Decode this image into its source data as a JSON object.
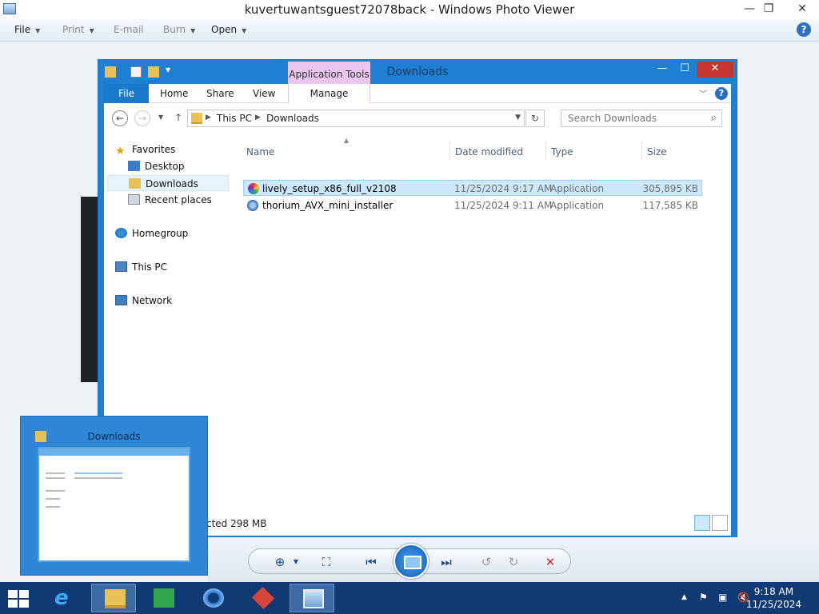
{
  "photo_viewer": {
    "title": "kuvertuwantsguest72078back - Windows Photo Viewer",
    "menu": {
      "file": "File",
      "print": "Print",
      "email": "E-mail",
      "burn": "Burn",
      "open": "Open"
    },
    "help": "?"
  },
  "explorer": {
    "title": "Downloads",
    "context_tab": "Application Tools",
    "tabs": {
      "file": "File",
      "home": "Home",
      "share": "Share",
      "view": "View",
      "manage": "Manage"
    },
    "breadcrumb": [
      "This PC",
      "Downloads"
    ],
    "search_placeholder": "Search Downloads",
    "nav": {
      "favorites": "Favorites",
      "desktop": "Desktop",
      "downloads": "Downloads",
      "recent": "Recent places",
      "homegroup": "Homegroup",
      "this_pc": "This PC",
      "network": "Network"
    },
    "columns": {
      "name": "Name",
      "date": "Date modified",
      "type": "Type",
      "size": "Size"
    },
    "files": [
      {
        "name": "lively_setup_x86_full_v2108",
        "date": "11/25/2024 9:17 AM",
        "type": "Application",
        "size": "305,895 KB"
      },
      {
        "name": "thorium_AVX_mini_installer",
        "date": "11/25/2024 9:11 AM",
        "type": "Application",
        "size": "117,585 KB"
      }
    ],
    "status": "cted  298 MB"
  },
  "thumbnail": {
    "title": "Downloads"
  },
  "clock": {
    "time": "9:18 AM",
    "date": "11/25/2024"
  },
  "colors": {
    "explorer_frame": "#1f7fd3",
    "taskbar": "#0f3a73",
    "selection": "#cce8ff",
    "close": "#c7372f"
  }
}
